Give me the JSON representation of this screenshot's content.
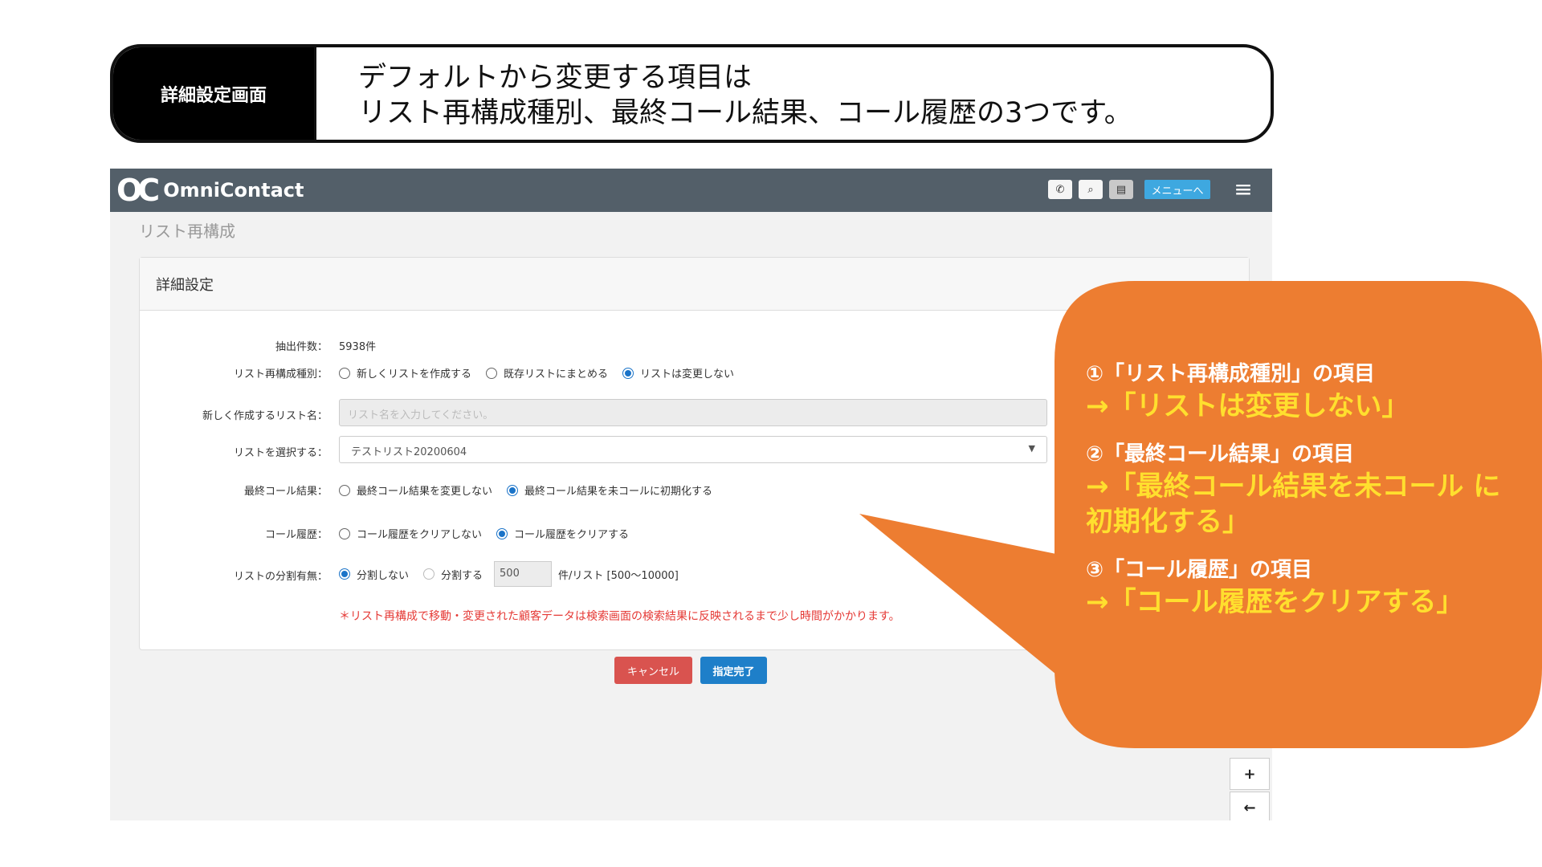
{
  "banner": {
    "label": "詳細設定画面",
    "line1": "デフォルトから変更する項目は",
    "line2": "リスト再構成種別、最終コール結果、コール履歴の3つです。"
  },
  "topbar": {
    "logo_text": "OmniContact",
    "menu_label": "メニューへ"
  },
  "page": {
    "title": "リスト再構成",
    "panel_title": "詳細設定"
  },
  "form": {
    "count_label": "抽出件数：",
    "count_value": "5938件",
    "type_label": "リスト再構成種別：",
    "type_options": [
      "新しくリストを作成する",
      "既存リストにまとめる",
      "リストは変更しない"
    ],
    "type_selected": "リストは変更しない",
    "newname_label": "新しく作成するリスト名：",
    "newname_placeholder": "リスト名を入力してください。",
    "select_label": "リストを選択する：",
    "select_value": "テストリスト20200604",
    "lastcall_label": "最終コール結果：",
    "lastcall_options": [
      "最終コール結果を変更しない",
      "最終コール結果を未コールに初期化する"
    ],
    "lastcall_selected": "最終コール結果を未コールに初期化する",
    "history_label": "コール履歴：",
    "history_options": [
      "コール履歴をクリアしない",
      "コール履歴をクリアする"
    ],
    "history_selected": "コール履歴をクリアする",
    "split_label": "リストの分割有無：",
    "split_options": [
      "分割しない",
      "分割する"
    ],
    "split_selected": "分割しない",
    "split_count": "500",
    "split_unit": "件/リスト [500〜10000]",
    "note": "＊リスト再構成で移動・変更された顧客データは検索画面の検索結果に反映されるまで少し時間がかかります。"
  },
  "buttons": {
    "cancel": "キャンセル",
    "ok": "指定完了",
    "plus": "+",
    "back": "←"
  },
  "callout": {
    "item1_head": "①「リスト再構成種別」の項目",
    "item1_value": "→「リストは変更しない」",
    "item2_head": "②「最終コール結果」の項目",
    "item2_value": "→「最終コール結果を未コール に初期化する」",
    "item3_head": "③「コール履歴」の項目",
    "item3_value": "→「コール履歴をクリアする」",
    "color": "#ed7d31",
    "highlight_color": "#ffdf2e"
  }
}
